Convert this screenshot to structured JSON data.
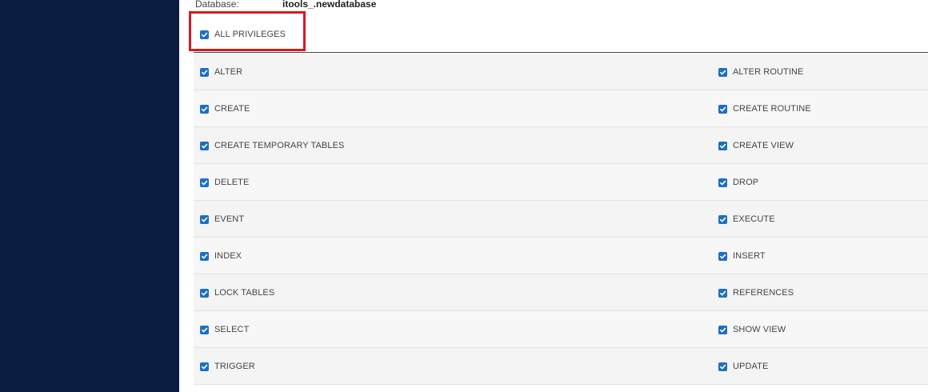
{
  "database": {
    "label": "Database:",
    "name": "itools_.newdatabase"
  },
  "all_privileges": {
    "label": "ALL PRIVILEGES",
    "checked": true
  },
  "privileges": [
    {
      "left": "ALTER",
      "right": "ALTER ROUTINE"
    },
    {
      "left": "CREATE",
      "right": "CREATE ROUTINE"
    },
    {
      "left": "CREATE TEMPORARY TABLES",
      "right": "CREATE VIEW"
    },
    {
      "left": "DELETE",
      "right": "DROP"
    },
    {
      "left": "EVENT",
      "right": "EXECUTE"
    },
    {
      "left": "INDEX",
      "right": "INSERT"
    },
    {
      "left": "LOCK TABLES",
      "right": "REFERENCES"
    },
    {
      "left": "SELECT",
      "right": "SHOW VIEW"
    },
    {
      "left": "TRIGGER",
      "right": "UPDATE"
    }
  ],
  "colors": {
    "sidebar": "#0a1c40",
    "checkbox": "#1d6fc4",
    "highlight": "#d71920"
  },
  "icons": {
    "checkbox": "checkmark-icon"
  }
}
